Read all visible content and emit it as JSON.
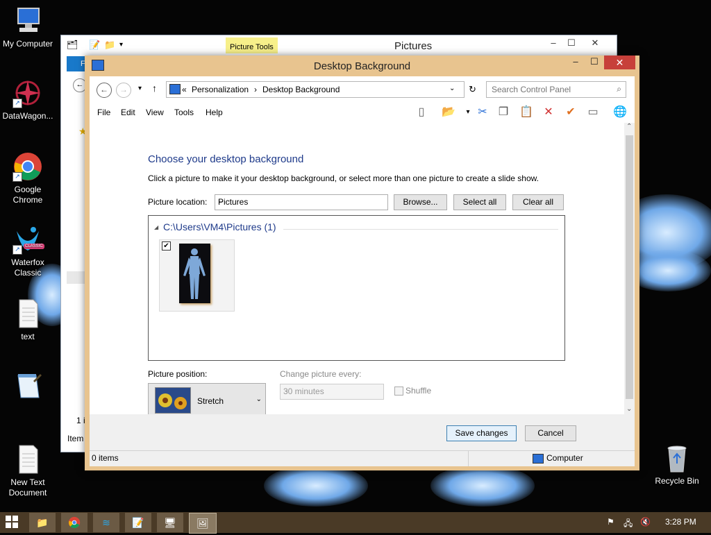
{
  "desktop": {
    "icons": [
      {
        "label": "My Computer"
      },
      {
        "label": "DataWagon..."
      },
      {
        "label": "Google Chrome"
      },
      {
        "label": "Waterfox Classic",
        "badge": "CLASSIC"
      },
      {
        "label": "text"
      },
      {
        "label": ""
      },
      {
        "label": "New Text Document"
      },
      {
        "label": "Recycle Bin"
      }
    ]
  },
  "back_window": {
    "title": "Pictures",
    "context_tab": "Picture Tools",
    "ribbon_tab": "Fi",
    "status_count": "1 i",
    "status_items": "Item"
  },
  "dialog": {
    "title": "Desktop Background",
    "address": {
      "prefix": "«",
      "crumbs": [
        "Personalization",
        "Desktop Background"
      ],
      "separator": "›"
    },
    "search": {
      "placeholder": "Search Control Panel"
    },
    "menu": [
      "File",
      "Edit",
      "View",
      "Tools",
      "Help"
    ],
    "heading": "Choose your desktop background",
    "instruction": "Click a picture to make it your desktop background, or select more than one picture to create a slide show.",
    "picture_location": {
      "label": "Picture location:",
      "value": "Pictures",
      "browse": "Browse...",
      "select_all": "Select all",
      "clear_all": "Clear all"
    },
    "gallery": {
      "group": "C:\\Users\\VM4\\Pictures (1)",
      "items": [
        {
          "checked": true
        }
      ]
    },
    "picture_position": {
      "label": "Picture position:",
      "value": "Stretch"
    },
    "change_picture": {
      "label": "Change picture every:",
      "value": "30 minutes",
      "enabled": false
    },
    "shuffle": {
      "label": "Shuffle",
      "checked": false,
      "enabled": false
    },
    "buttons": {
      "save": "Save changes",
      "cancel": "Cancel"
    },
    "status": {
      "items": "0 items",
      "location": "Computer"
    }
  },
  "taskbar": {
    "clock": "3:28 PM"
  }
}
